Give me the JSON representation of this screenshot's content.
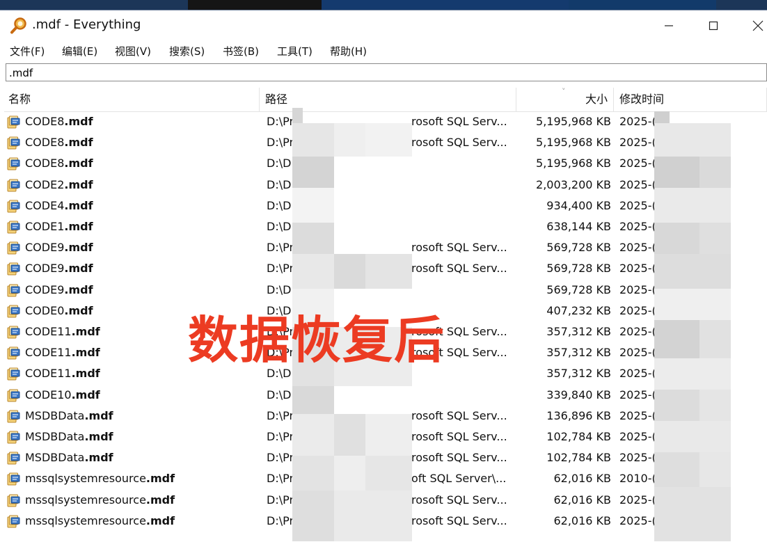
{
  "window": {
    "title": ".mdf - Everything"
  },
  "menu": [
    "文件(F)",
    "编辑(E)",
    "视图(V)",
    "搜索(S)",
    "书签(B)",
    "工具(T)",
    "帮助(H)"
  ],
  "search": {
    "value": ".mdf"
  },
  "columns": {
    "name": "名称",
    "path": "路径",
    "size": "大小",
    "modified": "修改时间"
  },
  "rows": [
    {
      "base": "CODE8",
      "ext": ".mdf",
      "path_start": "D:\\Pr",
      "path_end": "rosoft SQL Serv...",
      "size": "5,195,968 KB",
      "date": "2025-("
    },
    {
      "base": "CODE8",
      "ext": ".mdf",
      "path_start": "D:\\Pr",
      "path_end": "rosoft SQL Serv...",
      "size": "5,195,968 KB",
      "date": "2025-("
    },
    {
      "base": "CODE8",
      "ext": ".mdf",
      "path_start": "D:\\D",
      "path_end": "",
      "size": "5,195,968 KB",
      "date": "2025-("
    },
    {
      "base": "CODE2",
      "ext": ".mdf",
      "path_start": "D:\\D",
      "path_end": "",
      "size": "2,003,200 KB",
      "date": "2025-("
    },
    {
      "base": "CODE4",
      "ext": ".mdf",
      "path_start": "D:\\D",
      "path_end": "",
      "size": "934,400 KB",
      "date": "2025-("
    },
    {
      "base": "CODE1",
      "ext": ".mdf",
      "path_start": "D:\\D",
      "path_end": "",
      "size": "638,144 KB",
      "date": "2025-("
    },
    {
      "base": "CODE9",
      "ext": ".mdf",
      "path_start": "D:\\Pr",
      "path_end": "rosoft SQL Serv...",
      "size": "569,728 KB",
      "date": "2025-("
    },
    {
      "base": "CODE9",
      "ext": ".mdf",
      "path_start": "D:\\Pr",
      "path_end": "rosoft SQL Serv...",
      "size": "569,728 KB",
      "date": "2025-("
    },
    {
      "base": "CODE9",
      "ext": ".mdf",
      "path_start": "D:\\D",
      "path_end": "",
      "size": "569,728 KB",
      "date": "2025-("
    },
    {
      "base": "CODE0",
      "ext": ".mdf",
      "path_start": "D:\\D",
      "path_end": "",
      "size": "407,232 KB",
      "date": "2025-("
    },
    {
      "base": "CODE11",
      "ext": ".mdf",
      "path_start": "D:\\Pr",
      "path_end": "rosoft SQL Serv...",
      "size": "357,312 KB",
      "date": "2025-("
    },
    {
      "base": "CODE11",
      "ext": ".mdf",
      "path_start": "D:\\Pr",
      "path_end": "rosoft SQL Serv...",
      "size": "357,312 KB",
      "date": "2025-("
    },
    {
      "base": "CODE11",
      "ext": ".mdf",
      "path_start": "D:\\D",
      "path_end": "",
      "size": "357,312 KB",
      "date": "2025-("
    },
    {
      "base": "CODE10",
      "ext": ".mdf",
      "path_start": "D:\\D",
      "path_end": "",
      "size": "339,840 KB",
      "date": "2025-("
    },
    {
      "base": "MSDBData",
      "ext": ".mdf",
      "path_start": "D:\\Pr",
      "path_end": "rosoft SQL Serv...",
      "size": "136,896 KB",
      "date": "2025-("
    },
    {
      "base": "MSDBData",
      "ext": ".mdf",
      "path_start": "D:\\Pr",
      "path_end": "rosoft SQL Serv...",
      "size": "102,784 KB",
      "date": "2025-("
    },
    {
      "base": "MSDBData",
      "ext": ".mdf",
      "path_start": "D:\\Pr",
      "path_end": "rosoft SQL Serv...",
      "size": "102,784 KB",
      "date": "2025-("
    },
    {
      "base": "mssqlsystemresource",
      "ext": ".mdf",
      "path_start": "D:\\Pr",
      "path_end": "oft SQL Server\\...",
      "size": "62,016 KB",
      "date": "2010-("
    },
    {
      "base": "mssqlsystemresource",
      "ext": ".mdf",
      "path_start": "D:\\Pr",
      "path_end": "rosoft SQL Serv...",
      "size": "62,016 KB",
      "date": "2025-("
    },
    {
      "base": "mssqlsystemresource",
      "ext": ".mdf",
      "path_start": "D:\\Pr",
      "path_end": "rosoft SQL Serv...",
      "size": "62,016 KB",
      "date": "2025-("
    }
  ],
  "overlay": {
    "watermark": "数据恢复后"
  }
}
